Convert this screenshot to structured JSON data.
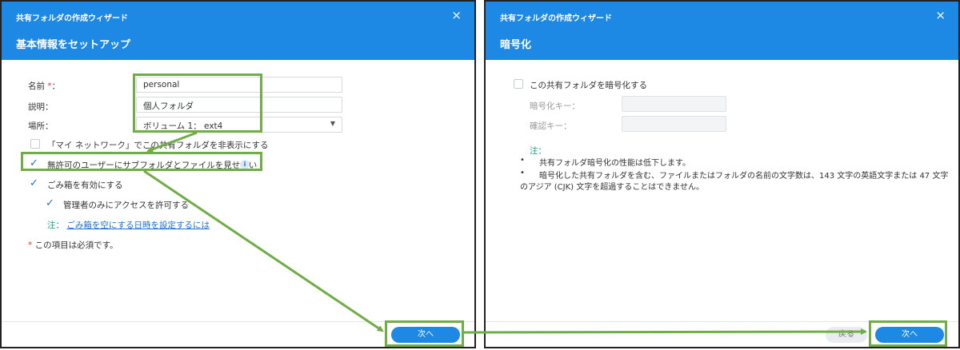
{
  "left_dialog": {
    "wizard_title": "共有フォルダの作成ウィザード",
    "step_title": "基本情報をセットアップ",
    "close": "×",
    "form": {
      "name_label": "名前",
      "required_mark": "*",
      "name_colon": "：",
      "name_value": "personal",
      "desc_label": "説明：",
      "desc_value": "個人フォルダ",
      "location_label": "場所：",
      "location_value": "ボリューム 1： ext4",
      "caret": "▼"
    },
    "options": {
      "hide_network": "「マイ ネットワーク」でこの共有フォルダを非表示にする",
      "hide_subfolders": "無許可のユーザーにサブフォルダとファイルを見せない",
      "recycle_bin": "ごみ箱を有効にする",
      "admin_only": "管理者のみにアクセスを許可する",
      "info_icon": "i",
      "check": "✓"
    },
    "note_label": "注：",
    "note_link": "ごみ箱を空にする日時を設定するには",
    "required_note": "この項目は必須です。",
    "next_button": "次へ"
  },
  "right_dialog": {
    "wizard_title": "共有フォルダの作成ウィザード",
    "step_title": "暗号化",
    "close": "×",
    "encrypt_checkbox": "この共有フォルダを暗号化する",
    "key_label": "暗号化キー：",
    "confirm_label": "確認キー：",
    "note_label": "注：",
    "bullet": "•",
    "bullet1": "共有フォルダ暗号化の性能は低下します。",
    "bullet2_line1": "暗号化した共有フォルダを含む、ファイルまたはフォルダの名前の文字数は、143 文字の英語文字または 47 文字",
    "bullet2_line2": "のアジア (CJK) 文字を超過することはできません。",
    "back_button": "戻る",
    "next_button": "次へ"
  },
  "annotation_color": "#70ad47",
  "accent_color": "#1e88e5"
}
